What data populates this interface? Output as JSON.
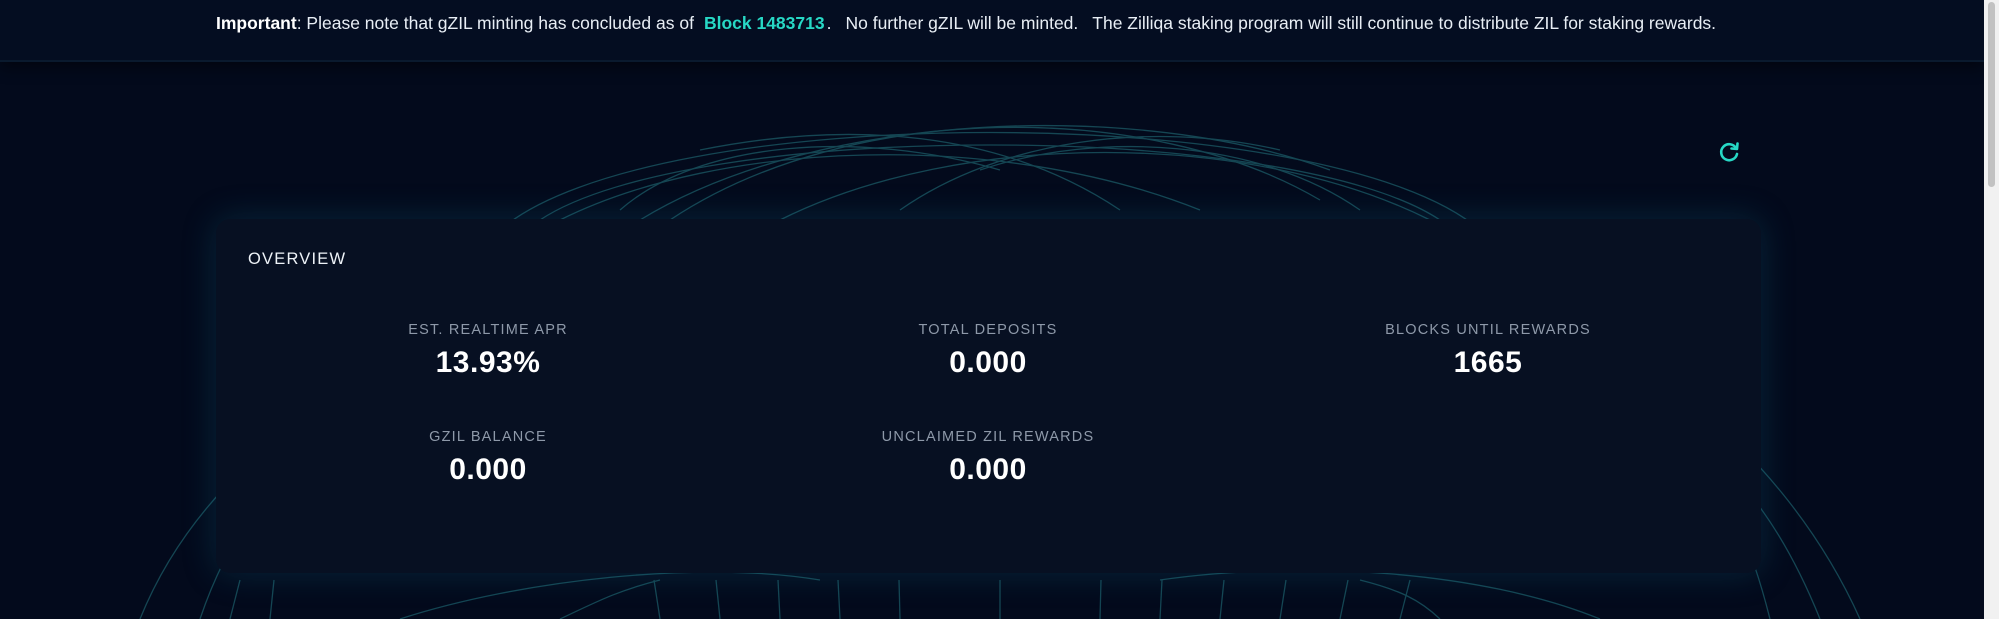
{
  "banner": {
    "important_label": "Important",
    "text_before_block": ": Please note that gZIL minting has concluded as of",
    "block_label": "Block 1483713",
    "text_after_block": ".",
    "no_further": "No further gZIL will be minted.",
    "staking_note": "The Zilliqa staking program will still continue to distribute ZIL for staking rewards."
  },
  "refresh": {
    "icon": "refresh-icon"
  },
  "overview": {
    "title": "OVERVIEW",
    "stats": [
      {
        "label": "EST. REALTIME APR",
        "value": "13.93%"
      },
      {
        "label": "TOTAL DEPOSITS",
        "value": "0.000"
      },
      {
        "label": "BLOCKS UNTIL REWARDS",
        "value": "1665"
      },
      {
        "label": "GZIL BALANCE",
        "value": "0.000"
      },
      {
        "label": "UNCLAIMED ZIL REWARDS",
        "value": "0.000"
      }
    ]
  },
  "colors": {
    "background": "#030a1c",
    "card": "#071022",
    "accent": "#27d8c5",
    "label": "#8e99a9"
  }
}
